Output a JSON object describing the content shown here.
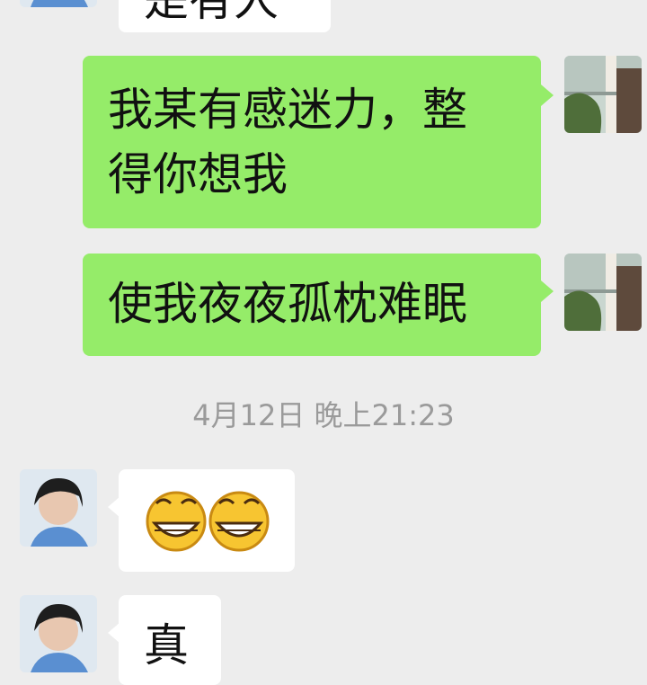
{
  "messages": [
    {
      "side": "theirs",
      "text": "是有人"
    },
    {
      "side": "mine",
      "line1": "我某有感迷力，整",
      "line2": "得你想我"
    },
    {
      "side": "mine",
      "text": "使我夜夜孤枕难眠"
    },
    {
      "side": "theirs",
      "text": "😁😁"
    },
    {
      "side": "theirs",
      "text": "真"
    }
  ],
  "timestamp": "4月12日 晚上21:23",
  "colors": {
    "background": "#ededed",
    "mine_bubble": "#95ec69",
    "theirs_bubble": "#ffffff",
    "timestamp_text": "#9a9a9a"
  },
  "icons": {
    "my_avatar": "avatar-balcony-photo",
    "their_avatar": "avatar-woman-photo",
    "emoji": "grinning-face-emoji"
  }
}
